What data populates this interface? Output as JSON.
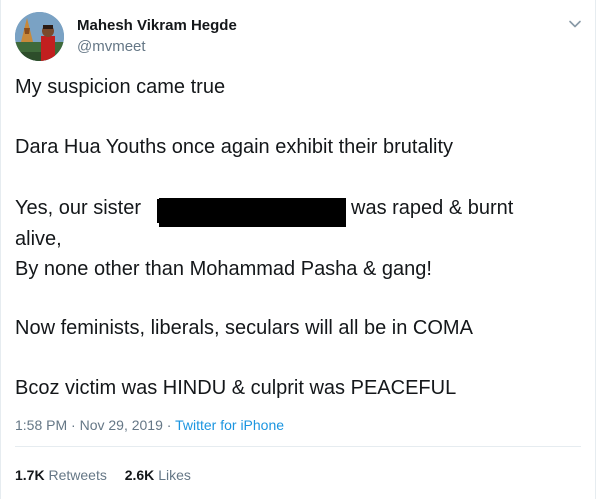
{
  "author": {
    "display_name": "Mahesh Vikram Hegde",
    "handle": "@mvmeet"
  },
  "icons": {
    "menu": "chevron-down-icon",
    "avatar": "avatar"
  },
  "tweet": {
    "line1": "My suspicion came true",
    "line2": "Dara Hua Youths once again exhibit their brutality",
    "line3_before": "Yes, our sister",
    "line3_after": "was raped & burnt",
    "line4": "alive,",
    "line5": "By none other than Mohammad Pasha & gang!",
    "line6": "Now feminists, liberals, seculars will all be in COMA",
    "line7": "Bcoz victim was HINDU & culprit was PEACEFUL"
  },
  "meta": {
    "time": "1:58 PM",
    "separator": "·",
    "date": "Nov 29, 2019",
    "source": "Twitter for iPhone"
  },
  "stats": {
    "retweets_count": "1.7K",
    "retweets_label": "Retweets",
    "likes_count": "2.6K",
    "likes_label": "Likes"
  },
  "colors": {
    "text": "#14171a",
    "secondary": "#657786",
    "link": "#1b95e0",
    "border": "#e6ecf0"
  }
}
